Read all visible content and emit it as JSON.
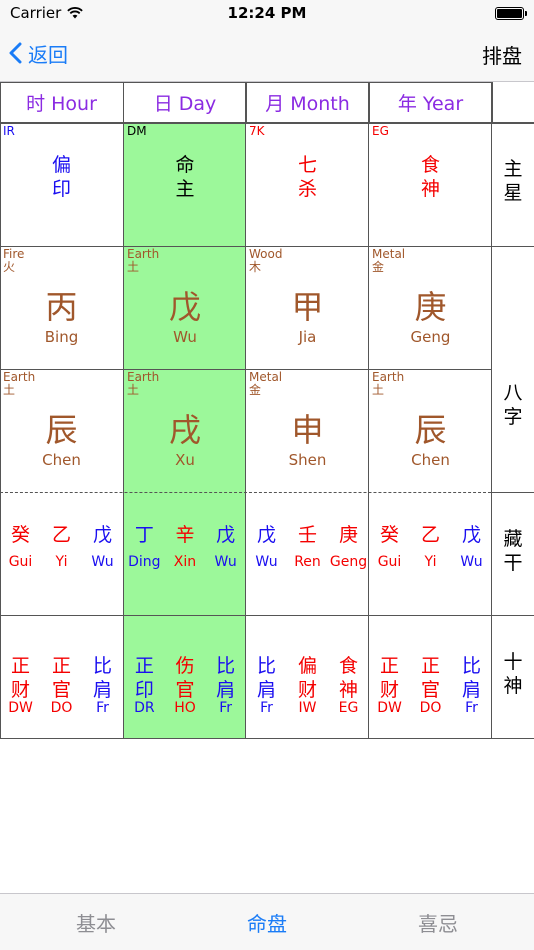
{
  "status": {
    "carrier": "Carrier",
    "time": "12:24 PM"
  },
  "nav": {
    "back_label": "返回",
    "title": "排盘"
  },
  "headers": [
    "时 Hour",
    "日 Day",
    "月 Month",
    "年 Year"
  ],
  "stars": [
    {
      "tag": "IR",
      "tag_color": "#1a0ef0",
      "line1": "偏",
      "line2": "印",
      "color": "#1a0ef0"
    },
    {
      "tag": "DM",
      "tag_color": "#000000",
      "line1": "命",
      "line2": "主",
      "color": "#000000"
    },
    {
      "tag": "7K",
      "tag_color": "#f40000",
      "line1": "七",
      "line2": "杀",
      "color": "#f40000"
    },
    {
      "tag": "EG",
      "tag_color": "#f40000",
      "line1": "食",
      "line2": "神",
      "color": "#f40000"
    }
  ],
  "stems": [
    {
      "element": "Fire",
      "element_cn": "火",
      "char": "丙",
      "pinyin": "Bing"
    },
    {
      "element": "Earth",
      "element_cn": "土",
      "char": "戊",
      "pinyin": "Wu"
    },
    {
      "element": "Wood",
      "element_cn": "木",
      "char": "甲",
      "pinyin": "Jia"
    },
    {
      "element": "Metal",
      "element_cn": "金",
      "char": "庚",
      "pinyin": "Geng"
    }
  ],
  "branches": [
    {
      "element": "Earth",
      "element_cn": "土",
      "char": "辰",
      "pinyin": "Chen"
    },
    {
      "element": "Earth",
      "element_cn": "土",
      "char": "戌",
      "pinyin": "Xu"
    },
    {
      "element": "Metal",
      "element_cn": "金",
      "char": "申",
      "pinyin": "Shen"
    },
    {
      "element": "Earth",
      "element_cn": "土",
      "char": "辰",
      "pinyin": "Chen"
    }
  ],
  "hidden_stems": [
    [
      {
        "cn": "癸",
        "py": "Gui",
        "c": "red"
      },
      {
        "cn": "乙",
        "py": "Yi",
        "c": "red"
      },
      {
        "cn": "戊",
        "py": "Wu",
        "c": "blue"
      }
    ],
    [
      {
        "cn": "丁",
        "py": "Ding",
        "c": "blue"
      },
      {
        "cn": "辛",
        "py": "Xin",
        "c": "red"
      },
      {
        "cn": "戊",
        "py": "Wu",
        "c": "blue"
      }
    ],
    [
      {
        "cn": "戊",
        "py": "Wu",
        "c": "blue"
      },
      {
        "cn": "壬",
        "py": "Ren",
        "c": "red"
      },
      {
        "cn": "庚",
        "py": "Geng",
        "c": "red"
      }
    ],
    [
      {
        "cn": "癸",
        "py": "Gui",
        "c": "red"
      },
      {
        "cn": "乙",
        "py": "Yi",
        "c": "red"
      },
      {
        "cn": "戊",
        "py": "Wu",
        "c": "blue"
      }
    ]
  ],
  "ten_gods": [
    [
      {
        "a": "正",
        "b": "财",
        "ab": "DW",
        "c": "red"
      },
      {
        "a": "正",
        "b": "官",
        "ab": "DO",
        "c": "red"
      },
      {
        "a": "比",
        "b": "肩",
        "ab": "Fr",
        "c": "blue"
      }
    ],
    [
      {
        "a": "正",
        "b": "印",
        "ab": "DR",
        "c": "blue"
      },
      {
        "a": "伤",
        "b": "官",
        "ab": "HO",
        "c": "red"
      },
      {
        "a": "比",
        "b": "肩",
        "ab": "Fr",
        "c": "blue"
      }
    ],
    [
      {
        "a": "比",
        "b": "肩",
        "ab": "Fr",
        "c": "blue"
      },
      {
        "a": "偏",
        "b": "财",
        "ab": "IW",
        "c": "red"
      },
      {
        "a": "食",
        "b": "神",
        "ab": "EG",
        "c": "red"
      }
    ],
    [
      {
        "a": "正",
        "b": "财",
        "ab": "DW",
        "c": "red"
      },
      {
        "a": "正",
        "b": "官",
        "ab": "DO",
        "c": "red"
      },
      {
        "a": "比",
        "b": "肩",
        "ab": "Fr",
        "c": "blue"
      }
    ]
  ],
  "side_labels": {
    "main_star": [
      "主",
      "星"
    ],
    "bazi": [
      "八",
      "字"
    ],
    "hidden": [
      "藏",
      "干"
    ],
    "ten_gods": [
      "十",
      "神"
    ]
  },
  "tabs": [
    {
      "label": "基本",
      "active": false
    },
    {
      "label": "命盘",
      "active": true
    },
    {
      "label": "喜忌",
      "active": false
    }
  ]
}
